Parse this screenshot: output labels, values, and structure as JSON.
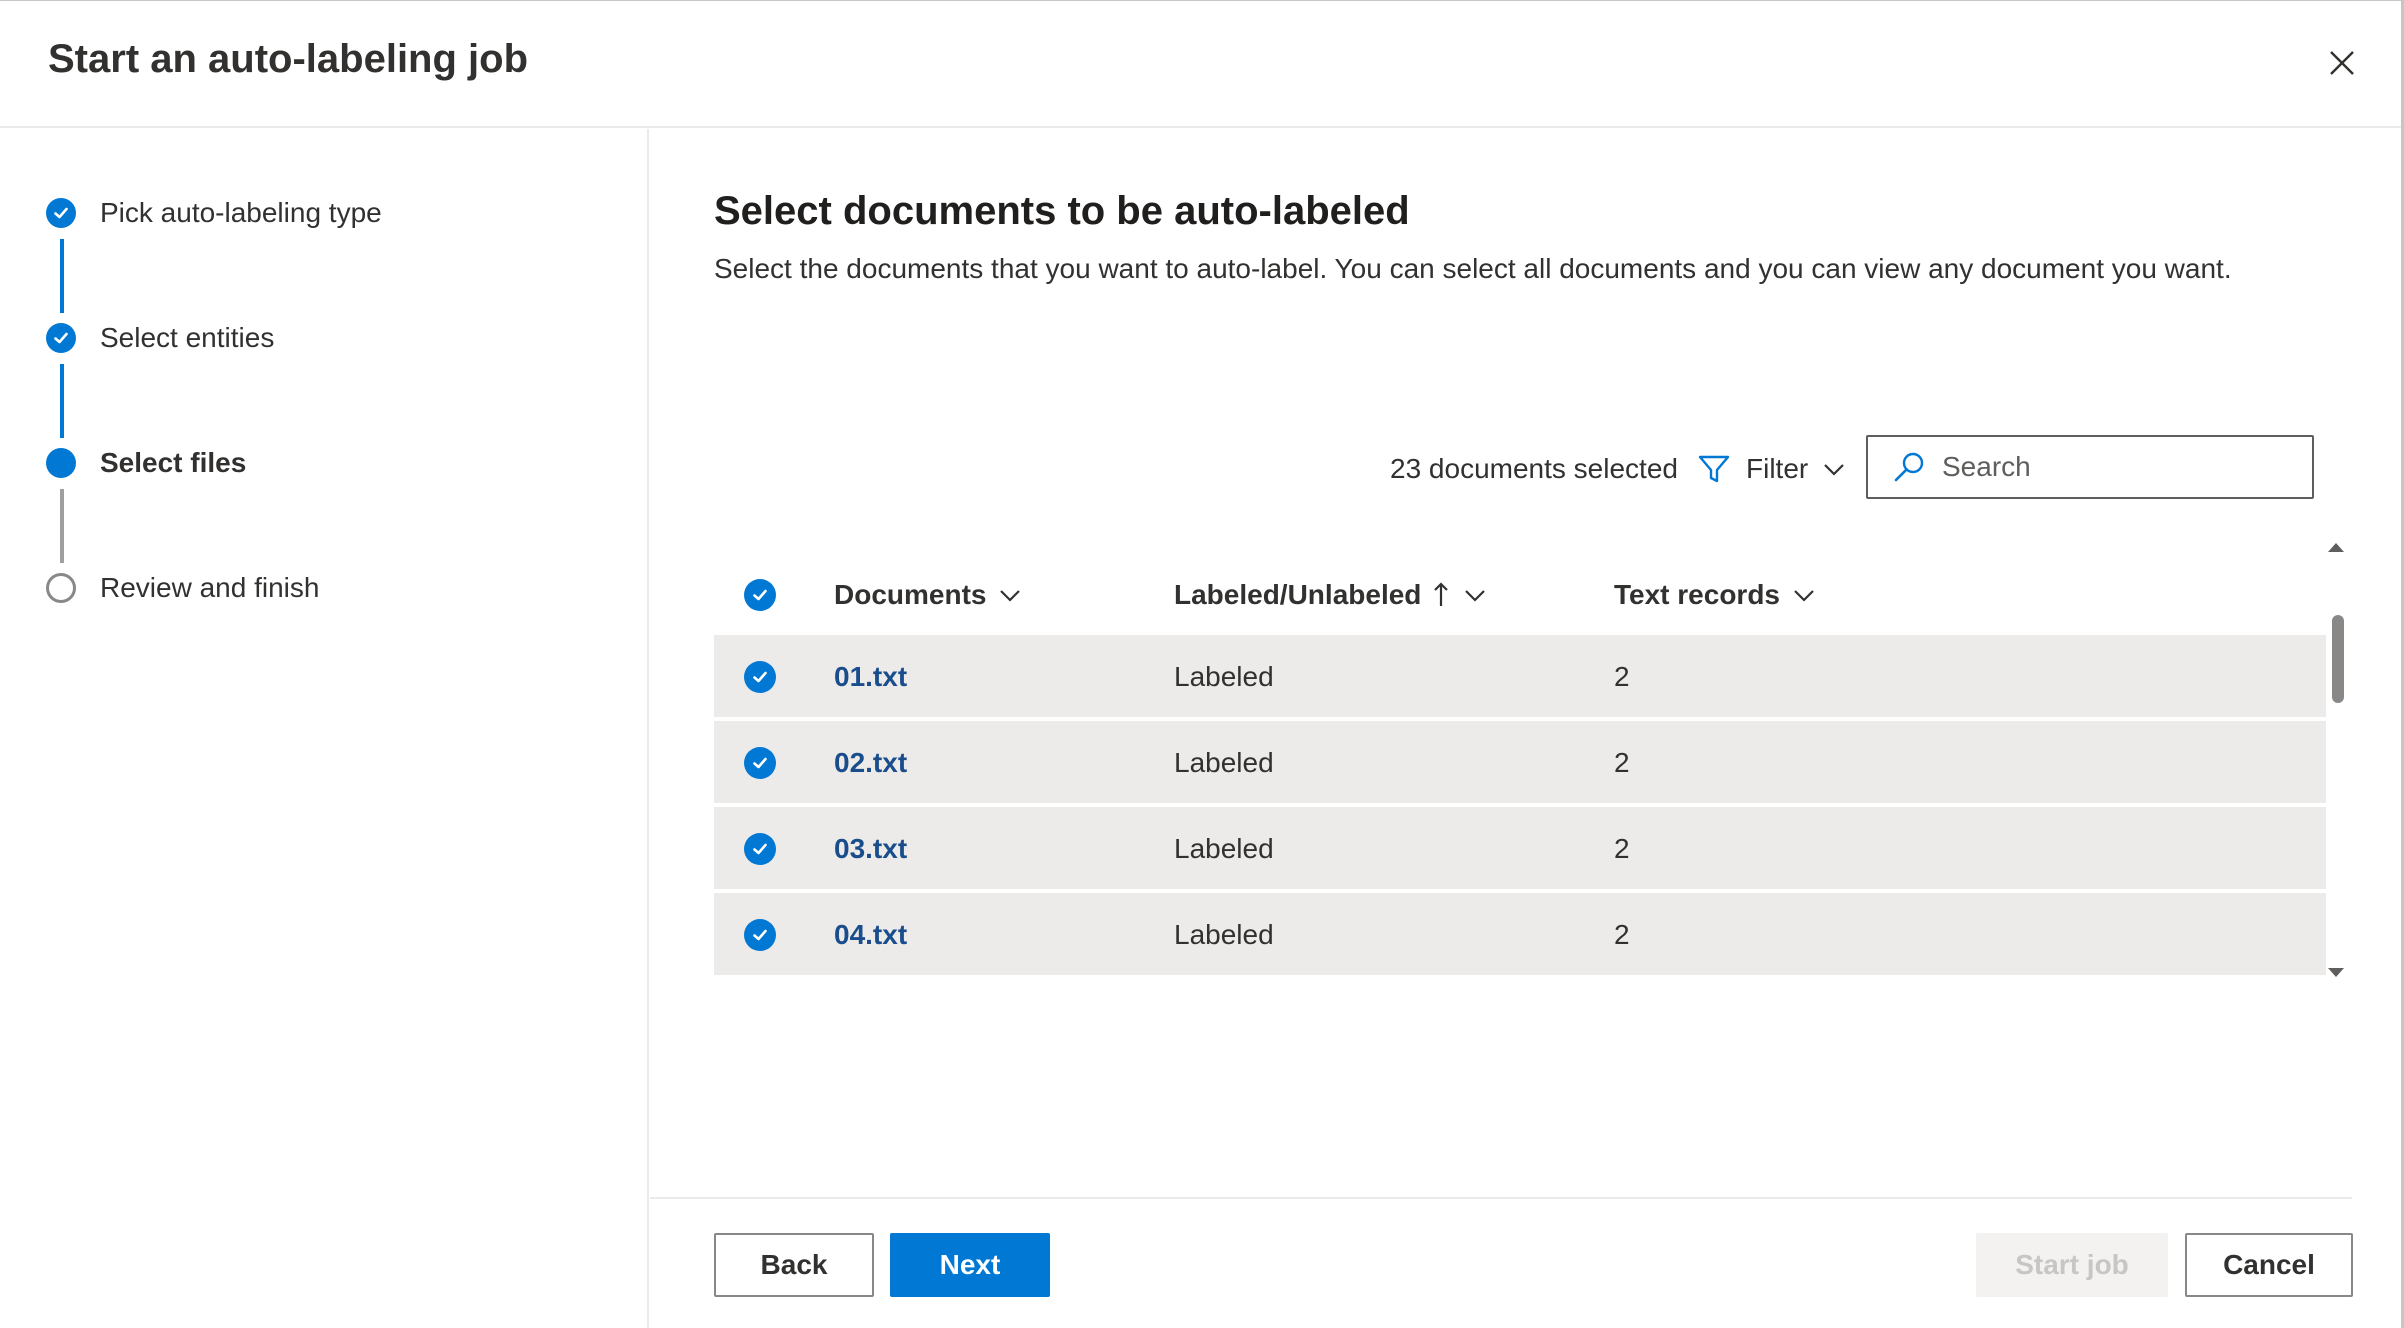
{
  "dialog": {
    "title": "Start an auto-labeling job",
    "close_icon": "close-icon"
  },
  "steps": [
    {
      "label": "Pick auto-labeling type",
      "state": "done"
    },
    {
      "label": "Select entities",
      "state": "done"
    },
    {
      "label": "Select files",
      "state": "current"
    },
    {
      "label": "Review and finish",
      "state": "todo"
    }
  ],
  "main": {
    "title": "Select documents to be auto-labeled",
    "description": "Select the documents that you want to auto-label. You can select all documents and you can view any document you want."
  },
  "toolbar": {
    "selected_count": "23 documents selected",
    "filter_label": "Filter",
    "search_placeholder": "Search"
  },
  "table": {
    "columns": [
      {
        "label": "Documents",
        "sort": "none"
      },
      {
        "label": "Labeled/Unlabeled",
        "sort": "ascending"
      },
      {
        "label": "Text records",
        "sort": "none"
      }
    ],
    "rows": [
      {
        "document": "01.txt",
        "status": "Labeled",
        "text_records": "2",
        "selected": true
      },
      {
        "document": "02.txt",
        "status": "Labeled",
        "text_records": "2",
        "selected": true
      },
      {
        "document": "03.txt",
        "status": "Labeled",
        "text_records": "2",
        "selected": true
      },
      {
        "document": "04.txt",
        "status": "Labeled",
        "text_records": "2",
        "selected": true
      }
    ]
  },
  "footer": {
    "back_label": "Back",
    "next_label": "Next",
    "start_label": "Start job",
    "cancel_label": "Cancel"
  },
  "colors": {
    "accent": "#0078d4",
    "row_background": "#edebe9",
    "link": "#1a4d8c",
    "disabled_text": "#c8c6c4"
  }
}
